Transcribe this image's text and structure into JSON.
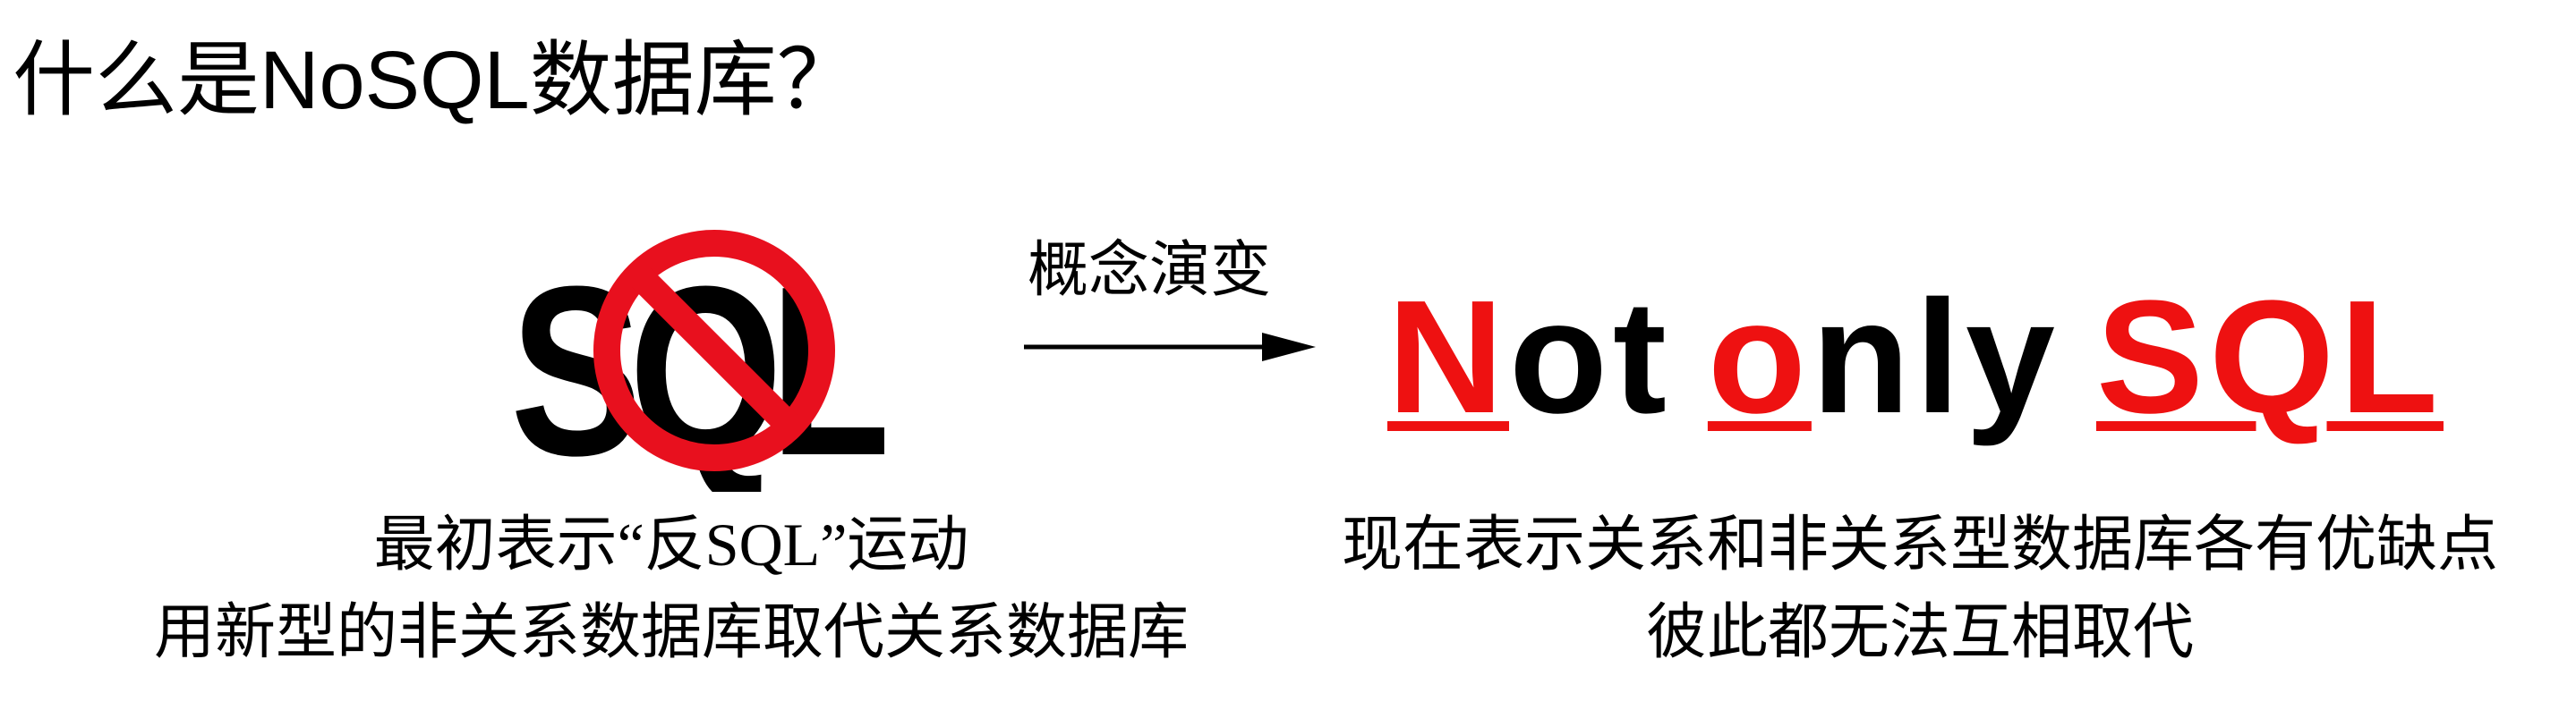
{
  "title": "什么是NoSQL数据库？",
  "logo": {
    "text": "SQL",
    "icon": "prohibition-sign-icon",
    "colors": {
      "text": "#000000",
      "prohibition": "#e8101e"
    }
  },
  "arrow": {
    "label": "概念演变",
    "icon": "right-arrow-icon"
  },
  "slogan": {
    "parts": [
      "N",
      "ot",
      "o",
      "nly",
      "SQL"
    ],
    "highlight_color": "#ee1111",
    "text_color": "#000000"
  },
  "left_description": {
    "line1": "最初表示“反SQL”运动",
    "line2": "用新型的非关系数据库取代关系数据库"
  },
  "right_description": {
    "line1": "现在表示关系和非关系型数据库各有优缺点",
    "line2": "彼此都无法互相取代"
  }
}
